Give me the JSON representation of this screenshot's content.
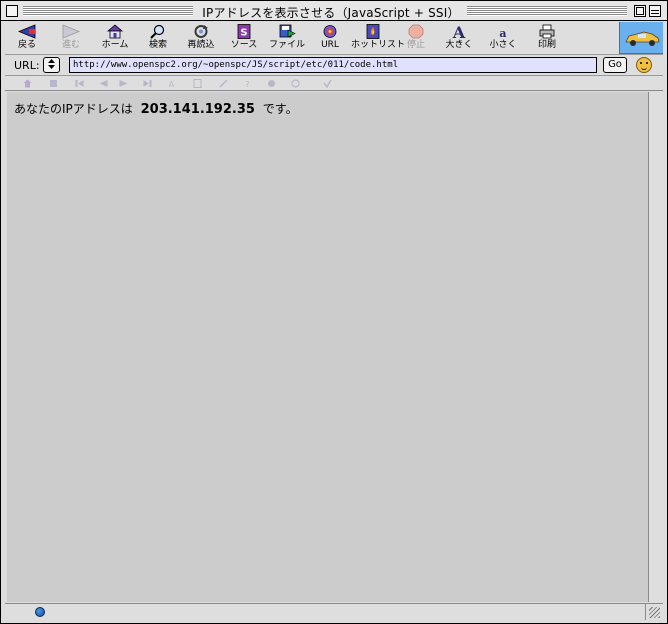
{
  "window": {
    "title": "IPアドレスを表示させる（JavaScript + SSI）"
  },
  "toolbar": {
    "buttons": [
      {
        "label": "戻る",
        "icon": "back-arrow-icon",
        "enabled": true
      },
      {
        "label": "進む",
        "icon": "forward-arrow-icon",
        "enabled": false
      },
      {
        "label": "ホーム",
        "icon": "home-icon",
        "enabled": true
      },
      {
        "label": "検索",
        "icon": "search-icon",
        "enabled": true
      },
      {
        "label": "再読込",
        "icon": "reload-icon",
        "enabled": true
      },
      {
        "label": "ソース",
        "icon": "source-icon",
        "enabled": true
      },
      {
        "label": "ファイル",
        "icon": "file-icon",
        "enabled": true
      },
      {
        "label": "URL",
        "icon": "url-icon",
        "enabled": true
      },
      {
        "label": "ホットリスト",
        "icon": "hotlist-icon",
        "enabled": true
      },
      {
        "label": "停止",
        "icon": "stop-icon",
        "enabled": false
      },
      {
        "label": "大きく",
        "icon": "larger-text-icon",
        "enabled": true
      },
      {
        "label": "小さく",
        "icon": "smaller-text-icon",
        "enabled": true
      },
      {
        "label": "印刷",
        "icon": "print-icon",
        "enabled": true
      }
    ]
  },
  "urlbar": {
    "label": "URL:",
    "value": "http://www.openspc2.org/~openspc/JS/script/etc/011/code.html",
    "go_label": "Go"
  },
  "content": {
    "prefix": "あなたのIPアドレスは",
    "ip": "203.141.192.35",
    "suffix": "です。"
  },
  "colors": {
    "content_bg": "#cccccc",
    "url_field_bg": "#e0e0ff",
    "chrome_bg": "#dedede",
    "logo_bg": "#6ab0ee"
  }
}
